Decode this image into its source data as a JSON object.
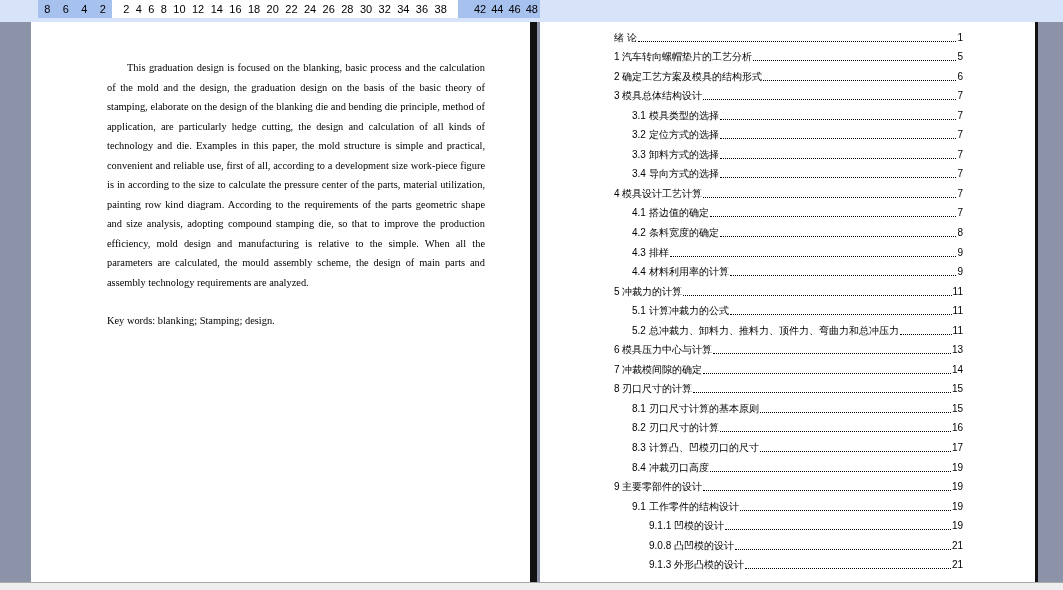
{
  "ruler": {
    "labels": [
      "8",
      "6",
      "4",
      "2",
      "2",
      "4",
      "6",
      "8",
      "10",
      "12",
      "14",
      "16",
      "18",
      "20",
      "22",
      "24",
      "26",
      "28",
      "30",
      "32",
      "34",
      "36",
      "38",
      "42",
      "44",
      "46",
      "48"
    ]
  },
  "abstract": {
    "body": "This graduation design is focused on the blanking, basic process and the calculation of the mold and the design, the graduation design on the basis of the basic theory of stamping, elaborate on the design of the blanking die and bending die principle, method of application, are particularly hedge cutting, the design and calculation of all kinds of technology and die. Examples in this paper, the mold structure is simple and practical, convenient and reliable use, first of all, according to a development size work-piece figure is in according to the size to calculate the pressure center of the parts, material utilization, painting row kind diagram. According to the requirements of the parts geometric shape and size analysis, adopting compound stamping die, so that to improve the production efficiency, mold design and manufacturing is relative to the simple. When all the parameters are calculated, the mould assembly scheme, the design of main parts and assembly technology requirements are analyzed.",
    "keywords": "Key words: blanking; Stamping; design."
  },
  "toc": [
    {
      "title": "绪  论",
      "page": "1"
    },
    {
      "title": "1  汽车转向螺帽垫片的工艺分析",
      "page": "5"
    },
    {
      "title": "2  确定工艺方案及模具的结构形式",
      "page": "6"
    },
    {
      "title": "3  模具总体结构设计",
      "page": "7",
      "children": [
        {
          "title": "3.1  模具类型的选择",
          "page": "7"
        },
        {
          "title": "3.2 定位方式的选择",
          "page": "7"
        },
        {
          "title": "3.3 卸料方式的选择",
          "page": "7"
        },
        {
          "title": "3.4 导向方式的选择",
          "page": "7"
        }
      ]
    },
    {
      "title": "4  模具设计工艺计算",
      "page": "7",
      "children": [
        {
          "title": "4.1 搭边值的确定",
          "page": "7"
        },
        {
          "title": "4.2 条料宽度的确定",
          "page": "8"
        },
        {
          "title": "4.3  排样",
          "page": "9"
        },
        {
          "title": "4.4 材料利用率的计算",
          "page": "9"
        }
      ]
    },
    {
      "title": "5  冲裁力的计算",
      "page": "11",
      "children": [
        {
          "title": "5.1 计算冲裁力的公式",
          "page": "11"
        },
        {
          "title": "5.2  总冲裁力、卸料力、推料力、顶件力、弯曲力和总冲压力",
          "page": "11"
        }
      ]
    },
    {
      "title": "6  模具压力中心与计算",
      "page": "13"
    },
    {
      "title": "7  冲裁模间隙的确定",
      "page": "14"
    },
    {
      "title": "8  刃口尺寸的计算",
      "page": "15",
      "children": [
        {
          "title": "8.1 刃口尺寸计算的基本原则",
          "page": "15"
        },
        {
          "title": "8.2 刃口尺寸的计算",
          "page": "16"
        },
        {
          "title": "8.3 计算凸、凹模刃口的尺寸",
          "page": "17"
        },
        {
          "title": "8.4 冲裁刃口高度",
          "page": "19"
        }
      ]
    },
    {
      "title": "9  主要零部件的设计",
      "page": "19",
      "children": [
        {
          "title": "9.1  工作零件的结构设计",
          "page": "19",
          "children": [
            {
              "title": "9.1.1 凹模的设计",
              "page": "19"
            },
            {
              "title": "9.0.8 凸凹模的设计",
              "page": "21"
            },
            {
              "title": "9.1.3 外形凸模的设计",
              "page": "21"
            }
          ]
        }
      ]
    }
  ]
}
